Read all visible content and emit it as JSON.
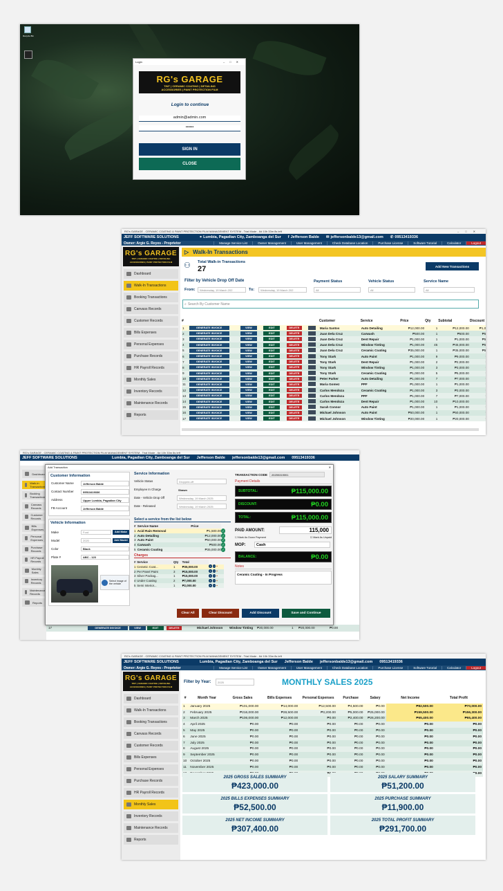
{
  "login": {
    "window_title": "Login",
    "recycle_bin": "Recycle Bin",
    "logo_title": "RG's GARAGE",
    "logo_sub1": "TINT | CERAMIC COATING | DETAILING",
    "logo_sub2": "ACCESSORIES | PAINT PROTECTION FILM",
    "heading": "Login to continue",
    "email": "admin@admin.com",
    "password": "••••••",
    "signin": "SIGN IN",
    "close": "CLOSE"
  },
  "app": {
    "title": "RG's GARAGE - CERAMIC COATING & PAINT PROTECTION FILM MANAGEMENT SYSTEM - Trial Mode - 6d 10h 33m 8s left",
    "company": "JEFF SOFTWARE SOLUTIONS",
    "location": "Lumbia, Pagadian City, Zamboanga del Sur",
    "facebook": "Jefferson Balde",
    "email": "jeffersonbalde13@gmail.com",
    "phone": "09513419336",
    "owner": "Owner: Argie G. Reyes - Proprietor",
    "menu": [
      "Manage Service List",
      "Owner Management",
      "User Management",
      "Check Database Location",
      "Purchase License",
      "Software Tutorial",
      "Calculator"
    ],
    "logout": "Logout",
    "sidebar": [
      "Dashboard",
      "Walk-In Transactions",
      "Booking Transactions",
      "Canvass Records",
      "Customer Records",
      "Bills Expenses",
      "Personal Expenses",
      "Purchase Records",
      "HR Payroll Records",
      "Monthly Sales",
      "Inventory Records",
      "Maintenance Records",
      "Reports"
    ]
  },
  "walkin": {
    "title": "Walk-In Transactions",
    "total_label": "Total Walk-in Transactions",
    "total": "27",
    "add_btn": "Add New Transactions",
    "filter_label": "Filter by Vehicle Drop Off Date",
    "from": "From:",
    "to": "To:",
    "from_date": "Wednesday, 19 March 202",
    "to_date": "Wednesday, 19 March 202",
    "payment_status": "Payment Status",
    "vehicle_status": "Vehicle Status",
    "service_name": "Service Name",
    "all": "All",
    "search": "Search By Customer Name",
    "cols": [
      "#",
      "",
      "",
      "",
      "",
      "",
      "Customer",
      "Service",
      "Price",
      "Qty",
      "Subtotal",
      "Discount",
      "T"
    ],
    "btn_gen": "GENERATE INVOICE",
    "btn_view": "VIEW",
    "btn_edit": "EDIT",
    "btn_del": "DELETE",
    "rows": [
      [
        "1",
        "Maria Santos",
        "Auto Detailing",
        "₱12,000.00",
        "1",
        "₱12,000.00",
        "₱1,000.00"
      ],
      [
        "2",
        "Juan Dela Cruz",
        "Carwash",
        "₱500.00",
        "1",
        "₱500.00",
        "₱500.00"
      ],
      [
        "3",
        "Juan Dela Cruz",
        "Dent Repair",
        "₱1,000.00",
        "1",
        "₱1,000.00",
        "₱500.00"
      ],
      [
        "4",
        "Juan Dela Cruz",
        "Window Tinting",
        "₱1,000.00",
        "45",
        "₱45,000.00",
        "₱500.00"
      ],
      [
        "5",
        "Juan Dela Cruz",
        "Ceramic Coating",
        "₱35,000.00",
        "1",
        "₱35,000.00",
        "₱500.00"
      ],
      [
        "6",
        "Tony Stark",
        "Auto Paint",
        "₱1,000.00",
        "9",
        "₱9,000.00",
        "₱0.00"
      ],
      [
        "7",
        "Tony Stark",
        "Dent Repair",
        "₱1,000.00",
        "2",
        "₱2,000.00",
        "₱0.00"
      ],
      [
        "8",
        "Tony Stark",
        "Window Tinting",
        "₱1,000.00",
        "3",
        "₱3,000.00",
        "₱0.00"
      ],
      [
        "9",
        "Tony Stark",
        "Ceramic Coating",
        "₱1,000.00",
        "5",
        "₱5,000.00",
        "₱0.00"
      ],
      [
        "10",
        "Peter Parker",
        "Auto Detailing",
        "₱1,000.00",
        "7",
        "₱7,000.00",
        "₱0.00"
      ],
      [
        "11",
        "Maria Gomez",
        "PPF",
        "₱1,000.00",
        "1",
        "₱1,000.00",
        "₱0.00"
      ],
      [
        "12",
        "Carlos Mendoza",
        "Ceramic Coating",
        "₱1,000.00",
        "3",
        "₱3,000.00",
        "₱0.00"
      ],
      [
        "13",
        "Carlos Mendoza",
        "PPF",
        "₱1,000.00",
        "7",
        "₱7,000.00",
        "₱0.00"
      ],
      [
        "14",
        "Carlos Mendoza",
        "Dent Repair",
        "₱1,000.00",
        "10",
        "₱10,000.00",
        "₱0.00"
      ],
      [
        "15",
        "Sarah Connor",
        "Auto Paint",
        "₱1,000.00",
        "1",
        "₱1,000.00",
        "₱0.00"
      ],
      [
        "16",
        "Michael Johnson",
        "Auto Paint",
        "₱50,000.00",
        "1",
        "₱50,000.00",
        "₱0.00"
      ],
      [
        "17",
        "Michael Johnson",
        "Window Tinting",
        "₱20,000.00",
        "1",
        "₱20,000.00",
        "₱0.00"
      ]
    ]
  },
  "addtx": {
    "title": "Add Transaction",
    "cust_info": "Customer Information",
    "cust_name_l": "Customer Name",
    "cust_name": "Jefferson Balde",
    "contact_l": "Contact Number",
    "contact": "09513419336",
    "address_l": "Address",
    "address": "Upper Lumbia, Pagadian City",
    "fb_l": "FB Account",
    "fb": "Jefferson Balde",
    "veh_info": "Vehicle Information",
    "make_l": "Make",
    "make": "Ford",
    "add_make": "Add Make",
    "model_l": "Model",
    "model": "2020",
    "add_model": "Add Model",
    "color_l": "Color",
    "color": "Black",
    "plate_l": "Plate #",
    "plate": "ABC - 123",
    "select_img": "Select image of the vehicle",
    "svc_info": "Service Information",
    "vstatus_l": "Vehicle Status",
    "vstatus": "Dropped-off",
    "emp_l": "Employee In Charge",
    "emp": "Shawn",
    "drop_l": "Date - Vehicle Drop Off",
    "drop": "Wednesday, 19 March 2025",
    "rel_l": "Date - Released",
    "rel": "Wednesday, 19 March 2025",
    "select_svc": "Select a service from the list below",
    "svc_cols": [
      "#",
      "Service Name",
      "Price"
    ],
    "svcs": [
      [
        "1",
        "Acid Rain Removal",
        "₱1,500.00"
      ],
      [
        "2",
        "Auto Detailing",
        "₱12,000.00"
      ],
      [
        "3",
        "Auto Paint",
        "₱50,000.00"
      ],
      [
        "4",
        "Carwash",
        "₱500.00"
      ],
      [
        "5",
        "Ceramic Coating",
        "₱35,000.00"
      ]
    ],
    "charges": "Charges",
    "ch_cols": [
      "#",
      "Service",
      "Qty",
      "Total"
    ],
    "chs": [
      [
        "1",
        "Ceramic Coat...",
        "1",
        "₱35,000.00"
      ],
      [
        "2",
        "Per Panel Paint",
        "3",
        "₱15,000.00"
      ],
      [
        "3",
        "Silver Packag...",
        "1",
        "₱15,000.00"
      ],
      [
        "4",
        "Under Coating",
        "2",
        "₱7,000.00"
      ],
      [
        "5",
        "Semi Interior...",
        "1",
        "₱2,000.00"
      ]
    ],
    "tx_code_l": "TRANSACTION CODE",
    "tx_code": "20250319001",
    "pay_details": "Payment Details",
    "subtotal_l": "SUBTOTAL:",
    "subtotal": "₱115,000.00",
    "discount_l": "DISCOUNT:",
    "discount": "₱0.00",
    "total_l": "TOTAL:",
    "total": "₱115,000.00",
    "paid_l": "PAID AMOUNT:",
    "paid": "115,000",
    "down": "Mark As Down Payment",
    "unpaid": "Mark As Unpaid",
    "mop_l": "MOP:",
    "mop": "Cash",
    "balance_l": "BALANCE:",
    "balance": "₱0.00",
    "notes_l": "Notes",
    "notes": "Ceramic Coating - In Progress",
    "clear_all": "Clear All",
    "clear_disc": "Clear Discount",
    "add_disc": "Add Discount",
    "save": "Save and Continue",
    "bg_row": [
      "17",
      "Michael Johnson",
      "Window Tinting",
      "₱20,000.00",
      "1",
      "₱20,000.00",
      "₱0.00"
    ]
  },
  "monthly": {
    "filter_l": "Filter by Year:",
    "year": "2025",
    "title": "MONTHLY SALES 2025",
    "cols": [
      "#",
      "Month Year",
      "Gross Sales",
      "Bills Expenses",
      "Personal Expenses",
      "Purchase",
      "Salary",
      "Net Income",
      "Total Profit"
    ],
    "rows": [
      [
        "1",
        "January 2025",
        "₱101,000.00",
        "₱14,000.00",
        "₱12,500.00",
        "₱4,500.00",
        "₱0.00",
        "₱82,500.00",
        "₱70,000.00"
      ],
      [
        "2",
        "February 2025",
        "₱216,000.00",
        "₱28,500.00",
        "₱3,200.00",
        "₱5,000.00",
        "₱25,000.00",
        "₱159,500.00",
        "₱156,300.00"
      ],
      [
        "3",
        "March 2025",
        "₱106,000.00",
        "₱12,000.00",
        "₱0.00",
        "₱2,400.00",
        "₱26,200.00",
        "₱65,400.00",
        "₱65,400.00"
      ],
      [
        "4",
        "April 2025",
        "₱0.00",
        "₱0.00",
        "₱0.00",
        "₱0.00",
        "₱0.00",
        "₱0.00",
        "₱0.00"
      ],
      [
        "5",
        "May 2025",
        "₱0.00",
        "₱0.00",
        "₱0.00",
        "₱0.00",
        "₱0.00",
        "₱0.00",
        "₱0.00"
      ],
      [
        "6",
        "June 2025",
        "₱0.00",
        "₱0.00",
        "₱0.00",
        "₱0.00",
        "₱0.00",
        "₱0.00",
        "₱0.00"
      ],
      [
        "7",
        "July 2025",
        "₱0.00",
        "₱0.00",
        "₱0.00",
        "₱0.00",
        "₱0.00",
        "₱0.00",
        "₱0.00"
      ],
      [
        "8",
        "August 2025",
        "₱0.00",
        "₱0.00",
        "₱0.00",
        "₱0.00",
        "₱0.00",
        "₱0.00",
        "₱0.00"
      ],
      [
        "9",
        "September 2025",
        "₱0.00",
        "₱0.00",
        "₱0.00",
        "₱0.00",
        "₱0.00",
        "₱0.00",
        "₱0.00"
      ],
      [
        "10",
        "October 2025",
        "₱0.00",
        "₱0.00",
        "₱0.00",
        "₱0.00",
        "₱0.00",
        "₱0.00",
        "₱0.00"
      ],
      [
        "11",
        "November 2025",
        "₱0.00",
        "₱0.00",
        "₱0.00",
        "₱0.00",
        "₱0.00",
        "₱0.00",
        "₱0.00"
      ],
      [
        "12",
        "December 2025",
        "₱0.00",
        "₱0.00",
        "₱0.00",
        "₱0.00",
        "₱0.00",
        "₱0.00",
        "₱0.00"
      ]
    ],
    "cards": [
      [
        "2025 GROSS SALES SUMMARY",
        "₱423,000.00"
      ],
      [
        "2025 SALARY SUMMARY",
        "₱51,200.00"
      ],
      [
        "2025 BILLS EXPENSES SUMMARY",
        "₱52,500.00"
      ],
      [
        "2025 PURCHASE SUMMARY",
        "₱11,900.00"
      ],
      [
        "2025 NET INCOME SUMMARY",
        "₱307,400.00"
      ],
      [
        "2025 TOTAL PROFIT SUMMARY",
        "₱291,700.00"
      ]
    ]
  }
}
